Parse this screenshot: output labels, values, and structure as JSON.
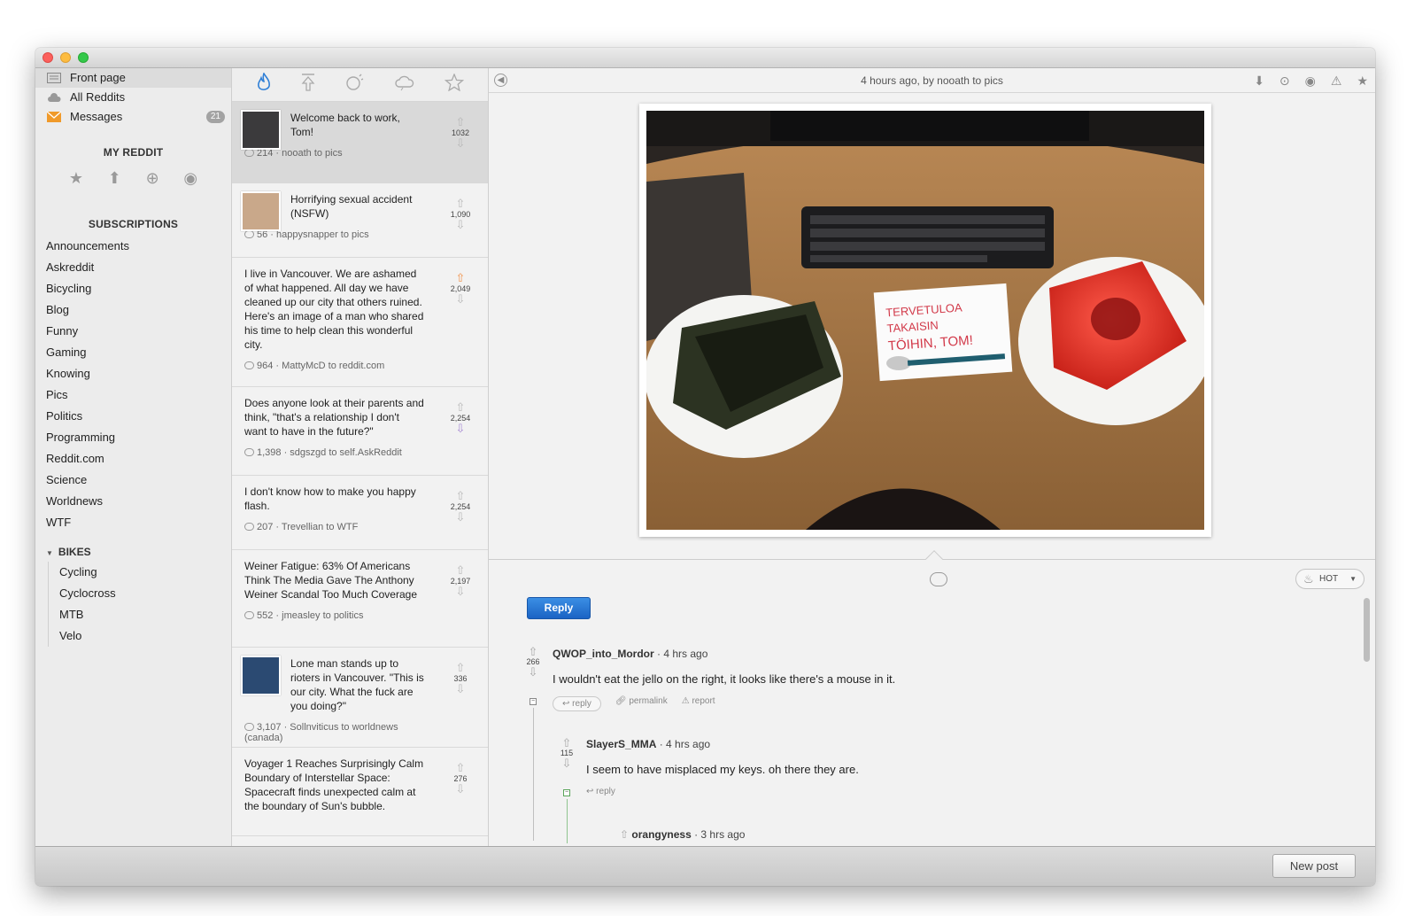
{
  "sidebar": {
    "nav": [
      {
        "label": "Front page",
        "icon": "front-page-icon"
      },
      {
        "label": "All Reddits",
        "icon": "cloud-icon"
      },
      {
        "label": "Messages",
        "icon": "envelope-icon",
        "badge": "21"
      }
    ],
    "my_reddit_title": "MY REDDIT",
    "subscriptions_title": "SUBSCRIPTIONS",
    "subscriptions": [
      "Announcements",
      "Askreddit",
      "Bicycling",
      "Blog",
      "Funny",
      "Gaming",
      "Knowing",
      "Pics",
      "Politics",
      "Programming",
      "Reddit.com",
      "Science",
      "Worldnews",
      "WTF"
    ],
    "group": {
      "title": "BIKES",
      "items": [
        "Cycling",
        "Cyclocross",
        "MTB",
        "Velo"
      ]
    }
  },
  "posts": [
    {
      "title": "Welcome back to work, Tom!",
      "score": "1032",
      "meta": "214 · nooath to pics"
    },
    {
      "title": "Horrifying sexual accident (NSFW)",
      "score": "1,090",
      "meta": "56 · happysnapper to pics"
    },
    {
      "title": "I live in Vancouver. We are ashamed of what happened. All day we have cleaned up our city that others ruined. Here's an image of a man who shared his time to help clean this wonderful city.",
      "score": "2,049",
      "meta": "964 · MattyMcD to reddit.com"
    },
    {
      "title": "Does anyone look at their parents and think, \"that's a relationship I don't want to have in the future?\"",
      "score": "2,254",
      "meta": "1,398 · sdgszgd to self.AskReddit"
    },
    {
      "title": "I don't know how to make you happy flash.",
      "score": "2,254",
      "meta": "207 · Trevellian to WTF"
    },
    {
      "title": "Weiner Fatigue: 63% Of Americans Think The Media Gave The Anthony Weiner Scandal Too Much Coverage",
      "score": "2,197",
      "meta": "552 · jmeasley to politics"
    },
    {
      "title": "Lone man stands up to rioters in Vancouver. \"This is our city. What the fuck are you doing?\"",
      "score": "336",
      "meta": "3,107 · Sollnviticus to worldnews (canada)"
    },
    {
      "title": "Voyager 1 Reaches Surprisingly Calm Boundary of Interstellar Space: Spacecraft finds unexpected calm at the boundary of Sun's bubble.",
      "score": "276",
      "meta": ""
    }
  ],
  "detail": {
    "header": "4 hours ago, by nooath to pics",
    "sort_label": "HOT",
    "reply_label": "Reply",
    "photo_note": "TERVETULOA TAKAISIN TÖIHIN, TOM!"
  },
  "comments": [
    {
      "author": "QWOP_into_Mordor",
      "time": "· 4 hrs ago",
      "score": "266",
      "body": "I wouldn't eat the jello on the right, it looks like there's a mouse in it.",
      "actions": [
        "reply",
        "permalink",
        "report"
      ]
    },
    {
      "author": "SlayerS_MMA",
      "time": "· 4 hrs ago",
      "score": "115",
      "body": "I seem to have misplaced my keys. oh there they are.",
      "actions": [
        "reply"
      ]
    },
    {
      "author": "orangyness",
      "time": "· 3 hrs ago"
    }
  ],
  "bottom": {
    "new_post_label": "New post"
  },
  "colors": {
    "accent": "#2f7fd6",
    "reply_button": "#1b63c4",
    "upvote": "#f0924a",
    "downvote": "#a88bd4"
  }
}
